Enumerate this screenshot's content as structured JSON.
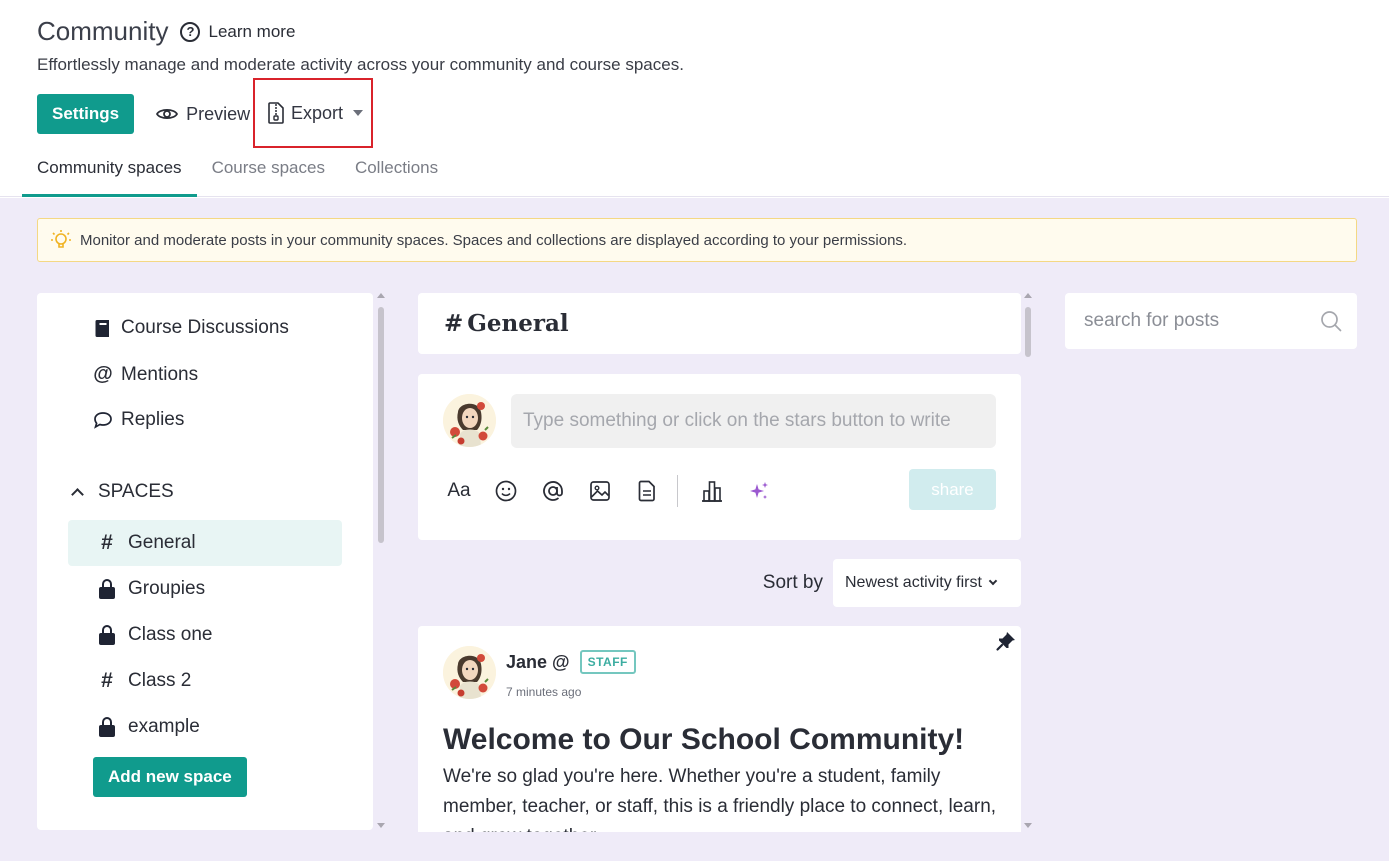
{
  "header": {
    "title": "Community",
    "help_label": "Learn more",
    "subtitle": "Effortlessly manage and moderate activity across your community and course spaces."
  },
  "actions": {
    "settings_label": "Settings",
    "preview_label": "Preview",
    "export_label": "Export"
  },
  "tabs": [
    {
      "label": "Community spaces",
      "active": true
    },
    {
      "label": "Course spaces",
      "active": false
    },
    {
      "label": "Collections",
      "active": false
    }
  ],
  "banner": {
    "text": "Monitor and moderate posts in your community spaces. Spaces and collections are displayed according to your permissions."
  },
  "sidebar": {
    "top_items": [
      {
        "icon": "book-icon",
        "label": "Course Discussions"
      },
      {
        "icon": "at-icon",
        "label": "Mentions"
      },
      {
        "icon": "speech-bubble-icon",
        "label": "Replies"
      }
    ],
    "spaces_heading": "SPACES",
    "spaces": [
      {
        "icon": "hash-icon",
        "label": "General",
        "active": true
      },
      {
        "icon": "lock-icon",
        "label": "Groupies",
        "active": false
      },
      {
        "icon": "lock-icon",
        "label": "Class one",
        "active": false
      },
      {
        "icon": "hash-icon",
        "label": "Class 2",
        "active": false
      },
      {
        "icon": "lock-icon",
        "label": "example",
        "active": false
      }
    ],
    "add_space_label": "Add new space"
  },
  "channel": {
    "name": "General",
    "hash": "#"
  },
  "composer": {
    "placeholder": "Type something or click on the stars button to write",
    "text_tool": "Aa",
    "share_label": "share"
  },
  "sort": {
    "label": "Sort by",
    "selected": "Newest activity first"
  },
  "post": {
    "author": "Jane @",
    "badge": "STAFF",
    "time": "7 minutes ago",
    "title": "Welcome to Our School Community!",
    "body": "We're so glad you're here. Whether you're a student, family member, teacher, or staff, this is a friendly place to connect, learn, and grow together."
  },
  "search": {
    "placeholder": "search for posts"
  },
  "colors": {
    "accent": "#109b8d",
    "page_bg": "#efebf8",
    "banner_bg": "#fffbee",
    "highlight_border": "#d9232b"
  }
}
